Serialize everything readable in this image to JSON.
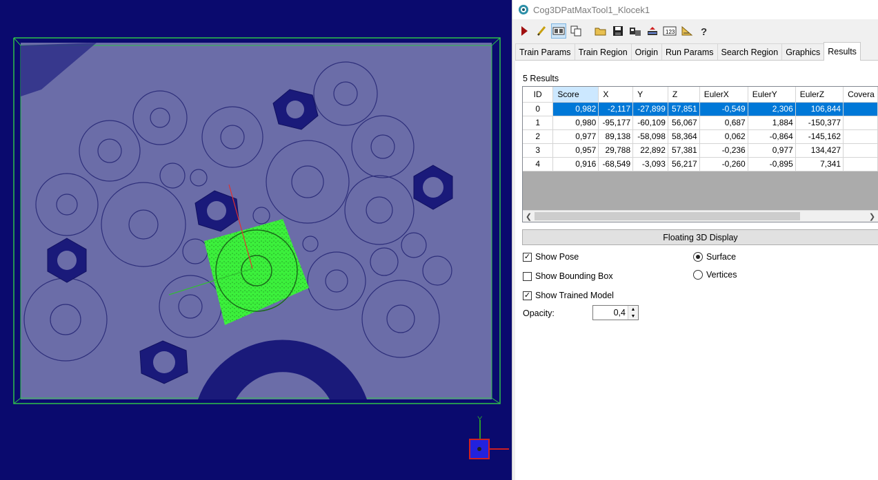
{
  "window": {
    "title": "Cog3DPatMaxTool1_Klocek1"
  },
  "toolbar": {
    "buttons": [
      "run-icon",
      "edit-icon",
      "display-toggle-icon",
      "copy-icon",
      "open-folder-icon",
      "save-icon",
      "export-icon",
      "reset-icon",
      "counter-icon",
      "measure-icon",
      "help-icon"
    ]
  },
  "tabs": [
    "Train Params",
    "Train Region",
    "Origin",
    "Run Params",
    "Search Region",
    "Graphics",
    "Results"
  ],
  "active_tab": "Results",
  "results": {
    "count_label": "5 Results",
    "columns": [
      "ID",
      "Score",
      "X",
      "Y",
      "Z",
      "EulerX",
      "EulerY",
      "EulerZ",
      "Covera"
    ],
    "rows": [
      [
        "0",
        "0,982",
        "-2,117",
        "-27,899",
        "57,851",
        "-0,549",
        "2,306",
        "106,844",
        ""
      ],
      [
        "1",
        "0,980",
        "-95,177",
        "-60,109",
        "56,067",
        "0,687",
        "1,884",
        "-150,377",
        ""
      ],
      [
        "2",
        "0,977",
        "89,138",
        "-58,098",
        "58,364",
        "0,062",
        "-0,864",
        "-145,162",
        ""
      ],
      [
        "3",
        "0,957",
        "29,788",
        "22,892",
        "57,381",
        "-0,236",
        "0,977",
        "134,427",
        ""
      ],
      [
        "4",
        "0,916",
        "-68,549",
        "-3,093",
        "56,217",
        "-0,260",
        "-0,895",
        "7,341",
        ""
      ]
    ],
    "selected_row": 0
  },
  "floating_display_label": "Floating 3D Display",
  "options": {
    "show_pose": {
      "label": "Show Pose",
      "checked": true
    },
    "show_bounding_box": {
      "label": "Show Bounding Box",
      "checked": false
    },
    "show_trained_model": {
      "label": "Show Trained Model",
      "checked": true
    },
    "surface": {
      "label": "Surface",
      "selected": true
    },
    "vertices": {
      "label": "Vertices",
      "selected": false
    }
  },
  "opacity": {
    "label": "Opacity:",
    "value": "0,4"
  },
  "viewport": {
    "axis_label_y": "Y",
    "colors": {
      "background": "#0a0a6e",
      "surface": "#6b6da8",
      "model": "#3cf03c",
      "bounding": "#2ec24a"
    }
  }
}
